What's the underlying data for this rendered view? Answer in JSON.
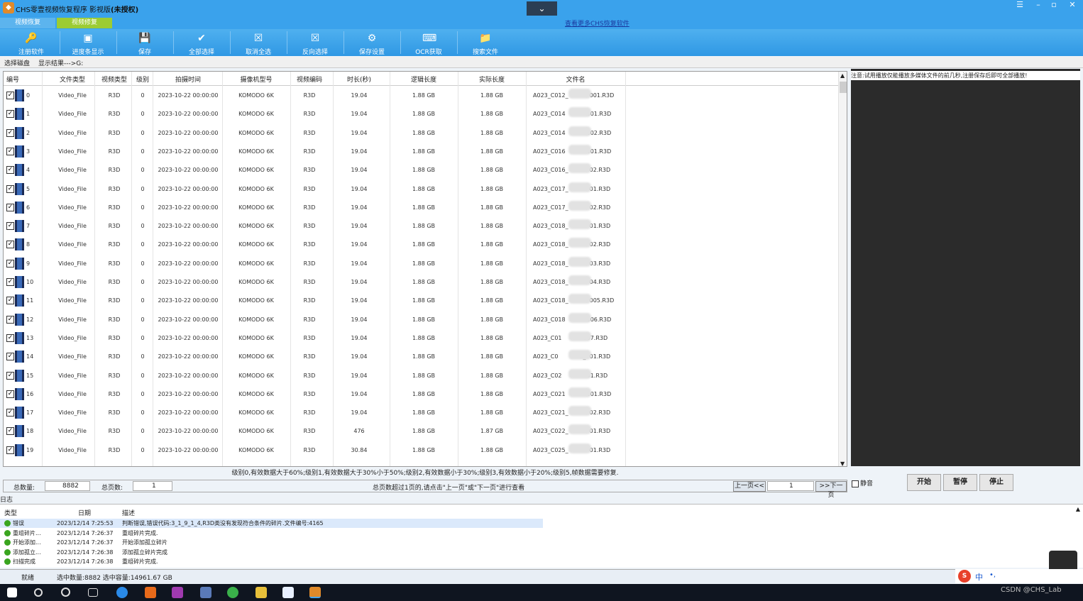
{
  "window": {
    "title": "CHS零壹视频恢复程序 影视版",
    "title_suffix": "(未授权)",
    "dropdown": "⌄",
    "more_link": "查看更多CHS恢复软件"
  },
  "tabs": [
    {
      "label": "视频恢复",
      "active": false
    },
    {
      "label": "视频修复",
      "active": true
    }
  ],
  "toolbar": [
    {
      "label": "注册软件",
      "icon": "key-icon",
      "glyph": "🔑"
    },
    {
      "label": "进度条显示",
      "icon": "progress-icon",
      "glyph": "▣"
    },
    {
      "label": "保存",
      "icon": "save-icon",
      "glyph": "💾"
    },
    {
      "label": "全部选择",
      "icon": "check-all-icon",
      "glyph": "✔"
    },
    {
      "label": "取消全选",
      "icon": "uncheck-icon",
      "glyph": "☒"
    },
    {
      "label": "反向选择",
      "icon": "invert-icon",
      "glyph": "☒"
    },
    {
      "label": "保存设置",
      "icon": "settings-icon",
      "glyph": "⚙"
    },
    {
      "label": "OCR获取",
      "icon": "ocr-icon",
      "glyph": "⌨"
    },
    {
      "label": "搜索文件",
      "icon": "folder-search-icon",
      "glyph": "📁"
    }
  ],
  "address": {
    "label": "选择磁盘",
    "path": "显示结果--->G:"
  },
  "columns": [
    "编号",
    "文件类型",
    "视频类型",
    "级别",
    "拍摄时间",
    "摄像机型号",
    "视频编码",
    "时长(秒)",
    "逻辑长度",
    "实际长度",
    "文件名"
  ],
  "rows": [
    {
      "id": "0",
      "type": "Video_File",
      "vtype": "R3D",
      "level": "0",
      "time": "2023-10-22 00:00:00",
      "camera": "KOMODO 6K",
      "codec": "R3D",
      "dur": "19.04",
      "logical": "1.88 GB",
      "actual": "1.88 GB",
      "fname_a": "A023_C012_",
      "fname_b": "001.R3D"
    },
    {
      "id": "1",
      "type": "Video_File",
      "vtype": "R3D",
      "level": "0",
      "time": "2023-10-22 00:00:00",
      "camera": "KOMODO 6K",
      "codec": "R3D",
      "dur": "19.04",
      "logical": "1.88 GB",
      "actual": "1.88 GB",
      "fname_a": "A023_C014",
      "fname_b": "001.R3D"
    },
    {
      "id": "2",
      "type": "Video_File",
      "vtype": "R3D",
      "level": "0",
      "time": "2023-10-22 00:00:00",
      "camera": "KOMODO 6K",
      "codec": "R3D",
      "dur": "19.04",
      "logical": "1.88 GB",
      "actual": "1.88 GB",
      "fname_a": "A023_C014",
      "fname_b": "002.R3D"
    },
    {
      "id": "3",
      "type": "Video_File",
      "vtype": "R3D",
      "level": "0",
      "time": "2023-10-22 00:00:00",
      "camera": "KOMODO 6K",
      "codec": "R3D",
      "dur": "19.04",
      "logical": "1.88 GB",
      "actual": "1.88 GB",
      "fname_a": "A023_C016",
      "fname_b": "001.R3D"
    },
    {
      "id": "4",
      "type": "Video_File",
      "vtype": "R3D",
      "level": "0",
      "time": "2023-10-22 00:00:00",
      "camera": "KOMODO 6K",
      "codec": "R3D",
      "dur": "19.04",
      "logical": "1.88 GB",
      "actual": "1.88 GB",
      "fname_a": "A023_C016_",
      "fname_b": "02.R3D"
    },
    {
      "id": "5",
      "type": "Video_File",
      "vtype": "R3D",
      "level": "0",
      "time": "2023-10-22 00:00:00",
      "camera": "KOMODO 6K",
      "codec": "R3D",
      "dur": "19.04",
      "logical": "1.88 GB",
      "actual": "1.88 GB",
      "fname_a": "A023_C017_",
      "fname_b": "01.R3D"
    },
    {
      "id": "6",
      "type": "Video_File",
      "vtype": "R3D",
      "level": "0",
      "time": "2023-10-22 00:00:00",
      "camera": "KOMODO 6K",
      "codec": "R3D",
      "dur": "19.04",
      "logical": "1.88 GB",
      "actual": "1.88 GB",
      "fname_a": "A023_C017_",
      "fname_b": "02.R3D"
    },
    {
      "id": "7",
      "type": "Video_File",
      "vtype": "R3D",
      "level": "0",
      "time": "2023-10-22 00:00:00",
      "camera": "KOMODO 6K",
      "codec": "R3D",
      "dur": "19.04",
      "logical": "1.88 GB",
      "actual": "1.88 GB",
      "fname_a": "A023_C018_",
      "fname_b": "01.R3D"
    },
    {
      "id": "8",
      "type": "Video_File",
      "vtype": "R3D",
      "level": "0",
      "time": "2023-10-22 00:00:00",
      "camera": "KOMODO 6K",
      "codec": "R3D",
      "dur": "19.04",
      "logical": "1.88 GB",
      "actual": "1.88 GB",
      "fname_a": "A023_C018_",
      "fname_b": "02.R3D"
    },
    {
      "id": "9",
      "type": "Video_File",
      "vtype": "R3D",
      "level": "0",
      "time": "2023-10-22 00:00:00",
      "camera": "KOMODO 6K",
      "codec": "R3D",
      "dur": "19.04",
      "logical": "1.88 GB",
      "actual": "1.88 GB",
      "fname_a": "A023_C018_",
      "fname_b": "03.R3D"
    },
    {
      "id": "10",
      "type": "Video_File",
      "vtype": "R3D",
      "level": "0",
      "time": "2023-10-22 00:00:00",
      "camera": "KOMODO 6K",
      "codec": "R3D",
      "dur": "19.04",
      "logical": "1.88 GB",
      "actual": "1.88 GB",
      "fname_a": "A023_C018_",
      "fname_b": "04.R3D"
    },
    {
      "id": "11",
      "type": "Video_File",
      "vtype": "R3D",
      "level": "0",
      "time": "2023-10-22 00:00:00",
      "camera": "KOMODO 6K",
      "codec": "R3D",
      "dur": "19.04",
      "logical": "1.88 GB",
      "actual": "1.88 GB",
      "fname_a": "A023_C018_",
      "fname_b": "005.R3D"
    },
    {
      "id": "12",
      "type": "Video_File",
      "vtype": "R3D",
      "level": "0",
      "time": "2023-10-22 00:00:00",
      "camera": "KOMODO 6K",
      "codec": "R3D",
      "dur": "19.04",
      "logical": "1.88 GB",
      "actual": "1.88 GB",
      "fname_a": "A023_C018",
      "fname_b": "006.R3D"
    },
    {
      "id": "13",
      "type": "Video_File",
      "vtype": "R3D",
      "level": "0",
      "time": "2023-10-22 00:00:00",
      "camera": "KOMODO 6K",
      "codec": "R3D",
      "dur": "19.04",
      "logical": "1.88 GB",
      "actual": "1.88 GB",
      "fname_a": "A023_C01",
      "fname_b": "007.R3D"
    },
    {
      "id": "14",
      "type": "Video_File",
      "vtype": "R3D",
      "level": "0",
      "time": "2023-10-22 00:00:00",
      "camera": "KOMODO 6K",
      "codec": "R3D",
      "dur": "19.04",
      "logical": "1.88 GB",
      "actual": "1.88 GB",
      "fname_a": "A023_C0",
      "fname_b": "2_001.R3D"
    },
    {
      "id": "15",
      "type": "Video_File",
      "vtype": "R3D",
      "level": "0",
      "time": "2023-10-22 00:00:00",
      "camera": "KOMODO 6K",
      "codec": "R3D",
      "dur": "19.04",
      "logical": "1.88 GB",
      "actual": "1.88 GB",
      "fname_a": "A023_C02",
      "fname_b": "001.R3D"
    },
    {
      "id": "16",
      "type": "Video_File",
      "vtype": "R3D",
      "level": "0",
      "time": "2023-10-22 00:00:00",
      "camera": "KOMODO 6K",
      "codec": "R3D",
      "dur": "19.04",
      "logical": "1.88 GB",
      "actual": "1.88 GB",
      "fname_a": "A023_C021",
      "fname_b": "001.R3D"
    },
    {
      "id": "17",
      "type": "Video_File",
      "vtype": "R3D",
      "level": "0",
      "time": "2023-10-22 00:00:00",
      "camera": "KOMODO 6K",
      "codec": "R3D",
      "dur": "19.04",
      "logical": "1.88 GB",
      "actual": "1.88 GB",
      "fname_a": "A023_C021_",
      "fname_b": "02.R3D"
    },
    {
      "id": "18",
      "type": "Video_File",
      "vtype": "R3D",
      "level": "0",
      "time": "2023-10-22 00:00:00",
      "camera": "KOMODO 6K",
      "codec": "R3D",
      "dur": "476",
      "logical": "1.88 GB",
      "actual": "1.87 GB",
      "fname_a": "A023_C022_",
      "fname_b": "01.R3D"
    },
    {
      "id": "19",
      "type": "Video_File",
      "vtype": "R3D",
      "level": "0",
      "time": "2023-10-22 00:00:00",
      "camera": "KOMODO 6K",
      "codec": "R3D",
      "dur": "30.84",
      "logical": "1.88 GB",
      "actual": "1.88 GB",
      "fname_a": "A023_C025_",
      "fname_b": "01.R3D"
    }
  ],
  "legend": "级别0,有效数据大于60%;级别1,有效数据大于30%小于50%;级别2,有效数据小于30%;级别3,有效数据小于20%;级别5,帧数据需要修复.",
  "status": {
    "total_label": "总数量:",
    "total_value": "8882",
    "pages_label": "总页数:",
    "pages_value": "1",
    "page_hint": "总页数超过1页的,请点击\"上一页\"或\"下一页\"进行查看",
    "prev": "上一页<<",
    "page_input": "1",
    "next": ">>下一页"
  },
  "preview": {
    "note": "注意:试用播放仅能播放多媒体文件的前几秒,注册保存后即可全部播放!",
    "mute_label": "静音",
    "start": "开始",
    "pause": "暂停",
    "stop": "停止"
  },
  "log": {
    "label": "日志",
    "columns": [
      "类型",
      "日期",
      "描述"
    ],
    "entries": [
      {
        "type": "错误",
        "date": "2023/12/14 7:25:53",
        "desc": "判断错误,错误代码:3_1_9_1_4,R3D类没有发现符合条件的碎片.文件编号:4165"
      },
      {
        "type": "重组碎片...",
        "date": "2023/12/14 7:26:37",
        "desc": "重组碎片完成."
      },
      {
        "type": "开始添加...",
        "date": "2023/12/14 7:26:37",
        "desc": "开始添加孤立碎片"
      },
      {
        "type": "添加孤立...",
        "date": "2023/12/14 7:26:38",
        "desc": "添加孤立碎片完成"
      },
      {
        "type": "扫描完成",
        "date": "2023/12/14 7:26:38",
        "desc": "重组碎片完成."
      }
    ]
  },
  "statusbar": {
    "ready": "就绪",
    "selection": "选中数量:8882 选中容量:14961.67 GB"
  },
  "ime": {
    "lang": "中",
    "punct": "•,"
  },
  "watermark": "CSDN @CHS_Lab",
  "colors": {
    "accent": "#3aa2ec",
    "active_tab": "#9ccc34"
  }
}
